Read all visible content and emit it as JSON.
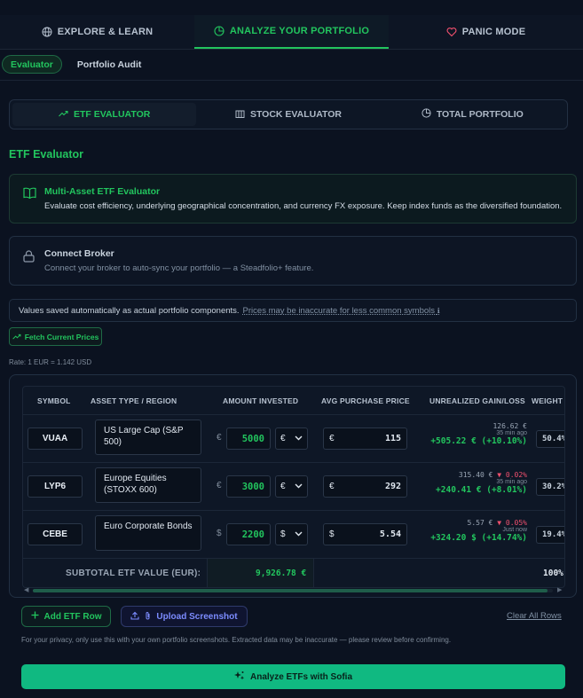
{
  "nav": {
    "tabs": [
      {
        "label": "EXPLORE & LEARN",
        "icon": "globe-icon"
      },
      {
        "label": "ANALYZE YOUR PORTFOLIO",
        "icon": "pie-chart-icon"
      },
      {
        "label": "PANIC MODE",
        "icon": "heart-icon"
      }
    ]
  },
  "subtabs": [
    "Evaluator",
    "Portfolio Audit"
  ],
  "segments": [
    "ETF EVALUATOR",
    "STOCK EVALUATOR",
    "TOTAL PORTFOLIO"
  ],
  "section_title": "ETF Evaluator",
  "info_card": {
    "title": "Multi-Asset ETF Evaluator",
    "desc": "Evaluate cost efficiency, underlying geographical concentration, and currency FX exposure. Keep index funds as the diversified foundation."
  },
  "broker_card": {
    "title": "Connect Broker",
    "desc": "Connect your broker to auto-sync your portfolio — a Steadfolio+ feature."
  },
  "note": {
    "text": "Values saved automatically as actual portfolio components.",
    "link": "Prices may be inaccurate for less common symbols ",
    "link_suffix": "ℹ"
  },
  "fetch_label": "Fetch Current Prices",
  "rate_text": "Rate: 1 EUR = 1.142 USD",
  "table": {
    "headers": [
      "SYMBOL",
      "ASSET TYPE / REGION",
      "AMOUNT INVESTED",
      "AVG PURCHASE PRICE",
      "UNREALIZED GAIN/LOSS",
      "WEIGHT"
    ],
    "rows": [
      {
        "symbol": "VUAA",
        "asset_type": "US Large Cap (S&P 500)",
        "cur_symbol": "€",
        "amount": "5000",
        "cur_select": "€",
        "avg_cur": "€",
        "avg_price": "115",
        "price": "126.62 €",
        "change": "",
        "updated": "35 min ago",
        "gain": "+505.22 € (+10.10%)",
        "weight": "50.4%"
      },
      {
        "symbol": "LYP6",
        "asset_type": "Europe Equities (STOXX 600)",
        "cur_symbol": "€",
        "amount": "3000",
        "cur_select": "€",
        "avg_cur": "€",
        "avg_price": "292",
        "price": "315.40 €",
        "change": "▼ 0.02%",
        "updated": "35 min ago",
        "gain": "+240.41 € (+8.01%)",
        "weight": "30.2%"
      },
      {
        "symbol": "CEBE",
        "asset_type": "Euro Corporate Bonds",
        "cur_symbol": "$",
        "amount": "2200",
        "cur_select": "$",
        "avg_cur": "$",
        "avg_price": "5.54",
        "price": "5.57 €",
        "change": "▼ 0.05%",
        "updated": "Just now",
        "gain": "+324.20 $ (+14.74%)",
        "weight": "19.4%"
      }
    ],
    "subtotal_label": "SUBTOTAL ETF VALUE (EUR):",
    "subtotal_value": "9,926.78 €",
    "subtotal_weight": "100%"
  },
  "actions": {
    "add_row": "Add ETF Row",
    "upload": "Upload Screenshot",
    "clear": "Clear All Rows"
  },
  "privacy_text": "For your privacy, only use this with your own portfolio screenshots. Extracted data may be inaccurate — please review before confirming.",
  "cta_label": "Analyze ETFs with Sofia",
  "colors": {
    "accent": "#22c55e",
    "danger": "#f0506e",
    "upload": "#7c8cff",
    "cta": "#10b981"
  }
}
